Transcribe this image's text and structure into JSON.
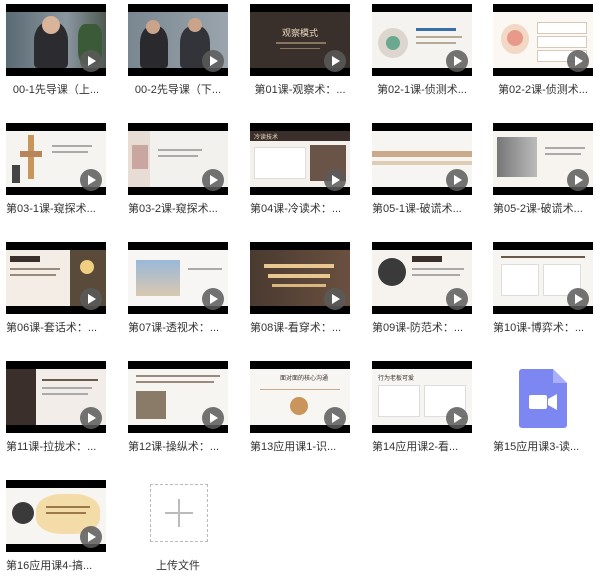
{
  "items": [
    {
      "label": "00-1先导课（上..."
    },
    {
      "label": "00-2先导课（下..."
    },
    {
      "label": "第01课-观察术：..."
    },
    {
      "label": "第02-1课-侦测术..."
    },
    {
      "label": "第02-2课-侦测术..."
    },
    {
      "label": "第03-1课-窥探术..."
    },
    {
      "label": "第03-2课-窥探术..."
    },
    {
      "label": "第04课-冷读术：..."
    },
    {
      "label": "第05-1课-破谎术..."
    },
    {
      "label": "第05-2课-破谎术..."
    },
    {
      "label": "第06课-套话术：..."
    },
    {
      "label": "第07课-透视术：..."
    },
    {
      "label": "第08课-看穿术：..."
    },
    {
      "label": "第09课-防范术：..."
    },
    {
      "label": "第10课-博弈术：..."
    },
    {
      "label": "第11课-拉拢术：..."
    },
    {
      "label": "第12课-操纵术：..."
    },
    {
      "label": "第13应用课1-识..."
    },
    {
      "label": "第14应用课2-看..."
    },
    {
      "label": "第15应用课3-读..."
    },
    {
      "label": "第16应用课4-搞..."
    },
    {
      "label": "上传文件"
    }
  ],
  "slide_text": {
    "s01": "观察模式",
    "s04": "冷读技术",
    "s13": "面对面的核心沟通",
    "s14": "行为老板可爱"
  },
  "icons": {
    "video_file": "video-file-icon",
    "play": "play-icon",
    "upload": "plus-icon"
  },
  "colors": {
    "doc_icon": "#7c87f2",
    "accent_brown": "#b8906a"
  }
}
